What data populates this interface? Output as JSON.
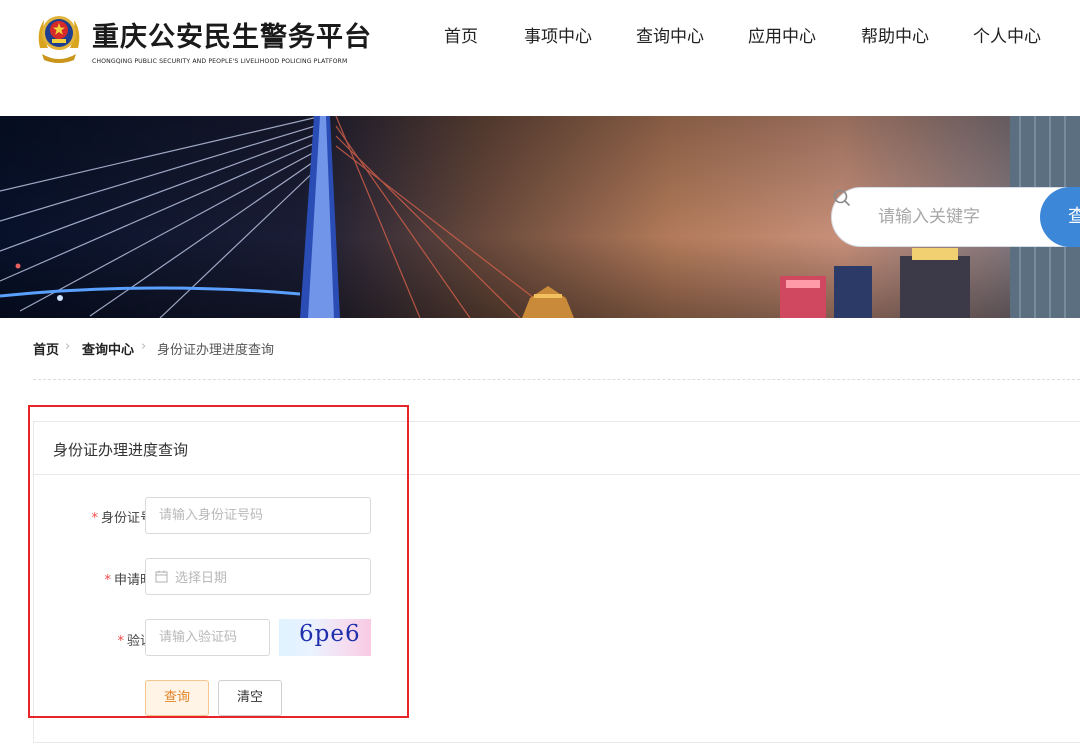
{
  "header": {
    "title": "重庆公安民生警务平台",
    "subtitle": "CHONGQING PUBLIC SECURITY AND PEOPLE'S LIVELIHOOD POLICING PLATFORM",
    "nav": [
      "首页",
      "事项中心",
      "查询中心",
      "应用中心",
      "帮助中心",
      "个人中心"
    ]
  },
  "banner": {
    "search_placeholder": "请输入关键字",
    "search_button": "查询"
  },
  "breadcrumb": {
    "items": [
      "首页",
      "查询中心",
      "身份证办理进度查询"
    ],
    "separator": "›"
  },
  "form": {
    "title": "身份证办理进度查询",
    "required_mark": "*",
    "id_label": "身份证号码",
    "id_placeholder": "请输入身份证号码",
    "date_label": "申请时间",
    "date_placeholder": "选择日期",
    "captcha_label": "验证码",
    "captcha_placeholder": "请输入验证码",
    "captcha_text": "6pe6",
    "query_button": "查询",
    "clear_button": "清空"
  },
  "colors": {
    "accent_blue": "#3d87d8",
    "highlight_red": "#e8242b",
    "query_button_text": "#e0842a",
    "required_red": "#f04848"
  },
  "icons": {
    "logo": "police-emblem-icon",
    "search": "search-icon",
    "date": "calendar-icon",
    "breadcrumb_separator": "chevron-right-icon"
  }
}
